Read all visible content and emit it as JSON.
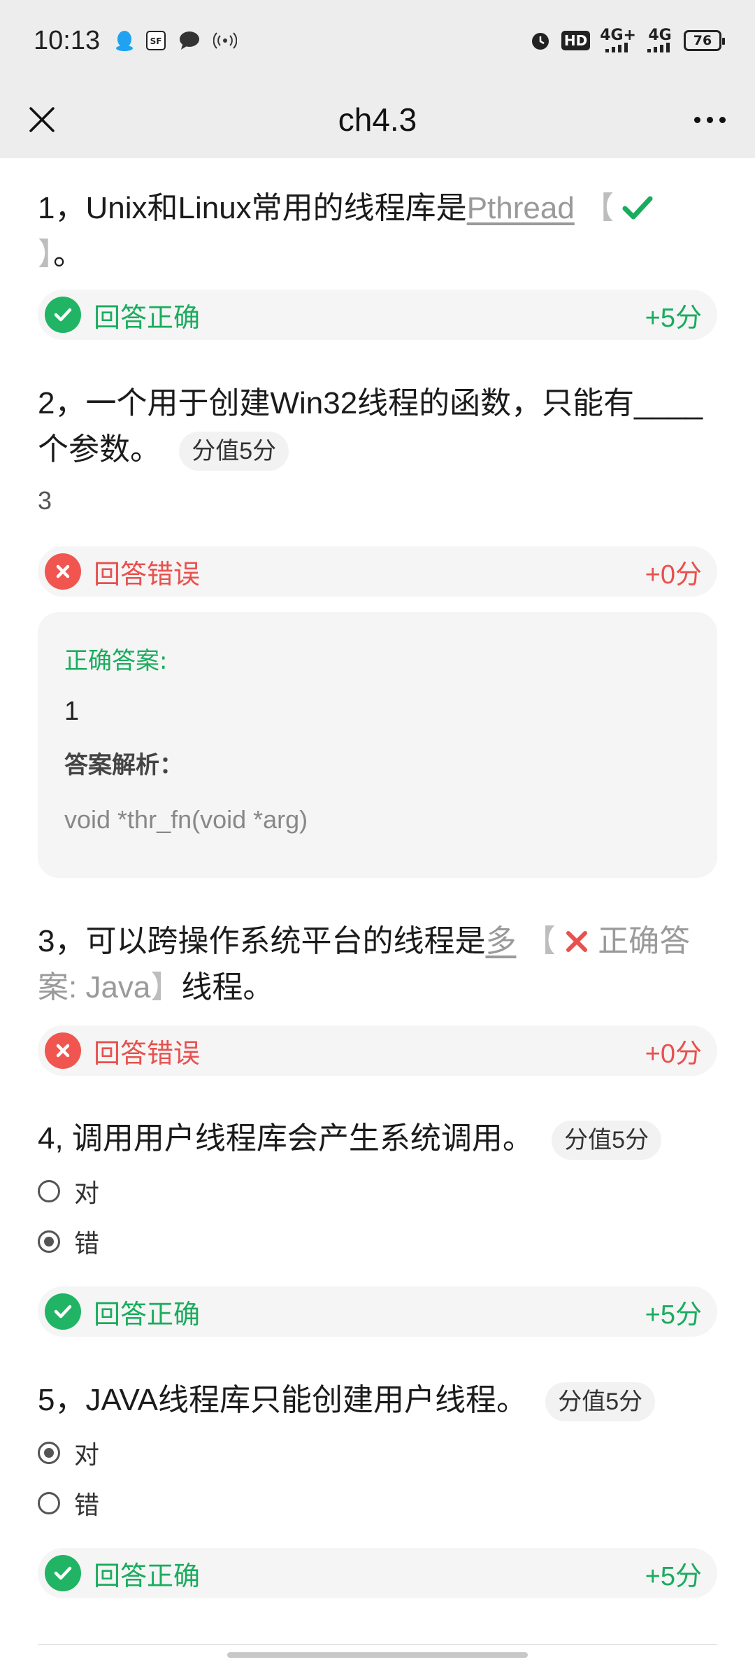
{
  "status_bar": {
    "time": "10:13",
    "icons_left": [
      "qq-icon",
      "sf-express-icon",
      "chat-bubble-icon",
      "hotspot-icon"
    ],
    "icons_right": [
      "alarm-icon",
      "hd-icon",
      "signal-4g-plus-icon",
      "signal-4g-icon"
    ],
    "hd": "HD",
    "net1": "4G+",
    "net2": "4G",
    "battery": "76"
  },
  "nav": {
    "title": "ch4.3"
  },
  "questions": [
    {
      "prefix": "1，Unix和Linux常用的线程库是",
      "answer": "Pthread",
      "bracket_open": " 【",
      "bracket_close": "】",
      "suffix": "。",
      "result": "回答正确",
      "score": "+5分"
    },
    {
      "text": "2，一个用于创建Win32线程的函数，只能有____个参数。",
      "score_tag": "分值5分",
      "user_answer": "3",
      "result": "回答错误",
      "score": "+0分",
      "correct_label": "正确答案:",
      "correct_value": "1",
      "explanation_label": "答案解析：",
      "explanation": "void *thr_fn(void *arg)"
    },
    {
      "prefix": "3，可以跨操作系统平台的线程是",
      "answer": "多",
      "bracket_open": " 【",
      "correct_text": "正确答案: Java",
      "bracket_close": "】",
      "suffix": "线程。",
      "result": "回答错误",
      "score": "+0分"
    },
    {
      "text": "4, 调用用户线程库会产生系统调用。",
      "score_tag": "分值5分",
      "options": [
        {
          "label": "对",
          "selected": false
        },
        {
          "label": "错",
          "selected": true
        }
      ],
      "result": "回答正确",
      "score": "+5分"
    },
    {
      "text": "5，JAVA线程库只能创建用户线程。",
      "score_tag": "分值5分",
      "options": [
        {
          "label": "对",
          "selected": true
        },
        {
          "label": "错",
          "selected": false
        }
      ],
      "result": "回答正确",
      "score": "+5分"
    }
  ],
  "colors": {
    "correct": "#1aac5e",
    "wrong": "#e8514e",
    "header_bg": "#ededed",
    "card_bg": "#f5f5f5"
  }
}
